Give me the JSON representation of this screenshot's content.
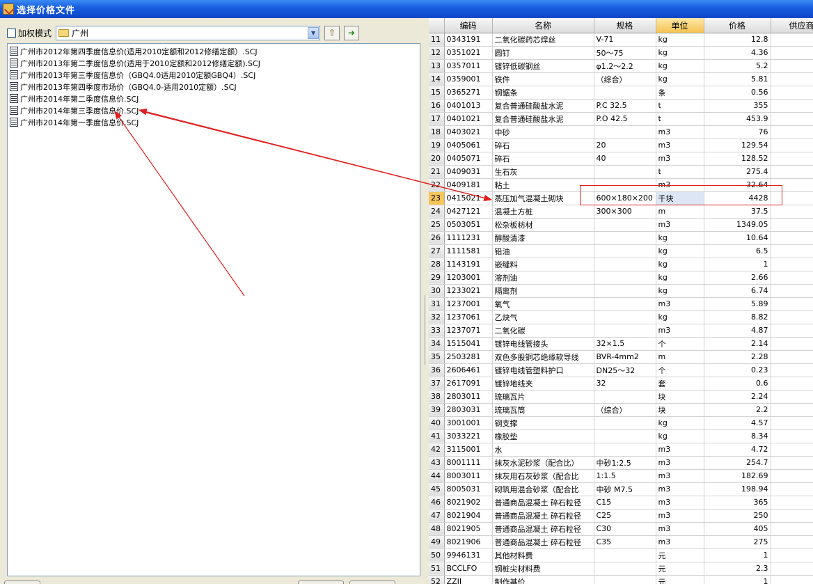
{
  "window": {
    "title": "选择价格文件"
  },
  "toolbar": {
    "weighted_label": "加权模式",
    "folder": "广州"
  },
  "files": [
    "广州市2012年第四季度信息价(适用2010定额和2012修缮定额）.SCJ",
    "广州市2013年第二季度信息价(适用于2010定额和2012修缮定额).SCJ",
    "广州市2013年第三季度信息价（GBQ4.0适用2010定额GBQ4）.SCJ",
    "广州市2013年第四季度市场价（GBQ4.0-适用2010定额）.SCJ",
    "广州市2014年第二季度信息价.SCJ",
    "广州市2014年第三季度信息价.SCJ",
    "广州市2014年第一季度信息价.SCJ"
  ],
  "grid": {
    "headers": [
      "编码",
      "名称",
      "规格",
      "单位",
      "价格",
      "供应商"
    ],
    "rows": [
      [
        "11",
        "0343191",
        "二氧化碳药芯焊丝",
        "V-71",
        "kg",
        "12.8"
      ],
      [
        "12",
        "0351021",
        "圆钉",
        "50～75",
        "kg",
        "4.36"
      ],
      [
        "13",
        "0357011",
        "镀锌低碳钢丝",
        "φ1.2～2.2",
        "kg",
        "5.2"
      ],
      [
        "14",
        "0359001",
        "铁件",
        "（综合）",
        "kg",
        "5.81"
      ],
      [
        "15",
        "0365271",
        "钢锯条",
        "",
        "条",
        "0.56"
      ],
      [
        "16",
        "0401013",
        "复合普通硅酸盐水泥",
        "P.C 32.5",
        "t",
        "355"
      ],
      [
        "17",
        "0401021",
        "复合普通硅酸盐水泥",
        "P.O 42.5",
        "t",
        "453.9"
      ],
      [
        "18",
        "0403021",
        "中砂",
        "",
        "m3",
        "76"
      ],
      [
        "19",
        "0405061",
        "碎石",
        "20",
        "m3",
        "129.54"
      ],
      [
        "20",
        "0405071",
        "碎石",
        "40",
        "m3",
        "128.52"
      ],
      [
        "21",
        "0409031",
        "生石灰",
        "",
        "t",
        "275.4"
      ],
      [
        "22",
        "0409181",
        "粘土",
        "",
        "m3",
        "32.64"
      ],
      [
        "23",
        "0415021",
        "蒸压加气混凝土砌块",
        "600×180×200",
        "千块",
        "4428"
      ],
      [
        "24",
        "0427121",
        "混凝土方桩",
        "300×300",
        "m",
        "37.5"
      ],
      [
        "25",
        "0503051",
        "松杂板枋材",
        "",
        "m3",
        "1349.05"
      ],
      [
        "26",
        "1111231",
        "醇酸清漆",
        "",
        "kg",
        "10.64"
      ],
      [
        "27",
        "1111581",
        "铅油",
        "",
        "kg",
        "6.5"
      ],
      [
        "28",
        "1143191",
        "嵌缝料",
        "",
        "kg",
        "1"
      ],
      [
        "29",
        "1203001",
        "溶剂油",
        "",
        "kg",
        "2.66"
      ],
      [
        "30",
        "1233021",
        "隔离剂",
        "",
        "kg",
        "6.74"
      ],
      [
        "31",
        "1237001",
        "氧气",
        "",
        "m3",
        "5.89"
      ],
      [
        "32",
        "1237061",
        "乙炔气",
        "",
        "kg",
        "8.82"
      ],
      [
        "33",
        "1237071",
        "二氧化碳",
        "",
        "m3",
        "4.87"
      ],
      [
        "34",
        "1515041",
        "镀锌电线管接头",
        "32×1.5",
        "个",
        "2.14"
      ],
      [
        "35",
        "2503281",
        "双色多股铜芯绝缘软导线",
        "BVR-4mm2",
        "m",
        "2.28"
      ],
      [
        "36",
        "2606461",
        "镀锌电线管塑料护口",
        "DN25～32",
        "个",
        "0.23"
      ],
      [
        "37",
        "2617091",
        "镀锌地线夹",
        "32",
        "套",
        "0.6"
      ],
      [
        "38",
        "2803011",
        "琉璃瓦片",
        "",
        "块",
        "2.24"
      ],
      [
        "39",
        "2803031",
        "琉璃瓦筒",
        "（综合）",
        "块",
        "2.2"
      ],
      [
        "40",
        "3001001",
        "钢支撑",
        "",
        "kg",
        "4.57"
      ],
      [
        "41",
        "3033221",
        "橡胶垫",
        "",
        "kg",
        "8.34"
      ],
      [
        "42",
        "3115001",
        "水",
        "",
        "m3",
        "4.72"
      ],
      [
        "43",
        "8001111",
        "抹灰水泥砂浆（配合比）",
        "中砂1:2.5",
        "m3",
        "254.7"
      ],
      [
        "44",
        "8003011",
        "抹灰用石灰砂浆（配合比",
        "1:1.5",
        "m3",
        "182.69"
      ],
      [
        "45",
        "8005031",
        "砌筑用混合砂浆（配合比",
        "中砂 M7.5",
        "m3",
        "198.94"
      ],
      [
        "46",
        "8021902",
        "普通商品混凝土 碎石粒径",
        "C15",
        "m3",
        "365"
      ],
      [
        "47",
        "8021904",
        "普通商品混凝土 碎石粒径",
        "C25",
        "m3",
        "250"
      ],
      [
        "48",
        "8021905",
        "普通商品混凝土 碎石粒径",
        "C30",
        "m3",
        "405"
      ],
      [
        "49",
        "8021906",
        "普通商品混凝土 碎石粒径",
        "C35",
        "m3",
        "275"
      ],
      [
        "50",
        "9946131",
        "其他材料费",
        "",
        "元",
        "1"
      ],
      [
        "51",
        "BCCLFO",
        "钢桩尖材料费",
        "",
        "元",
        "2.3"
      ],
      [
        "52",
        "ZZJJ",
        "制作基价",
        "",
        "元",
        "1"
      ]
    ],
    "selected_row": 12
  },
  "colors": {
    "annotation": "#e02020",
    "title_bar": "#0a46c8",
    "selected_row_header": "#f5c55a"
  }
}
